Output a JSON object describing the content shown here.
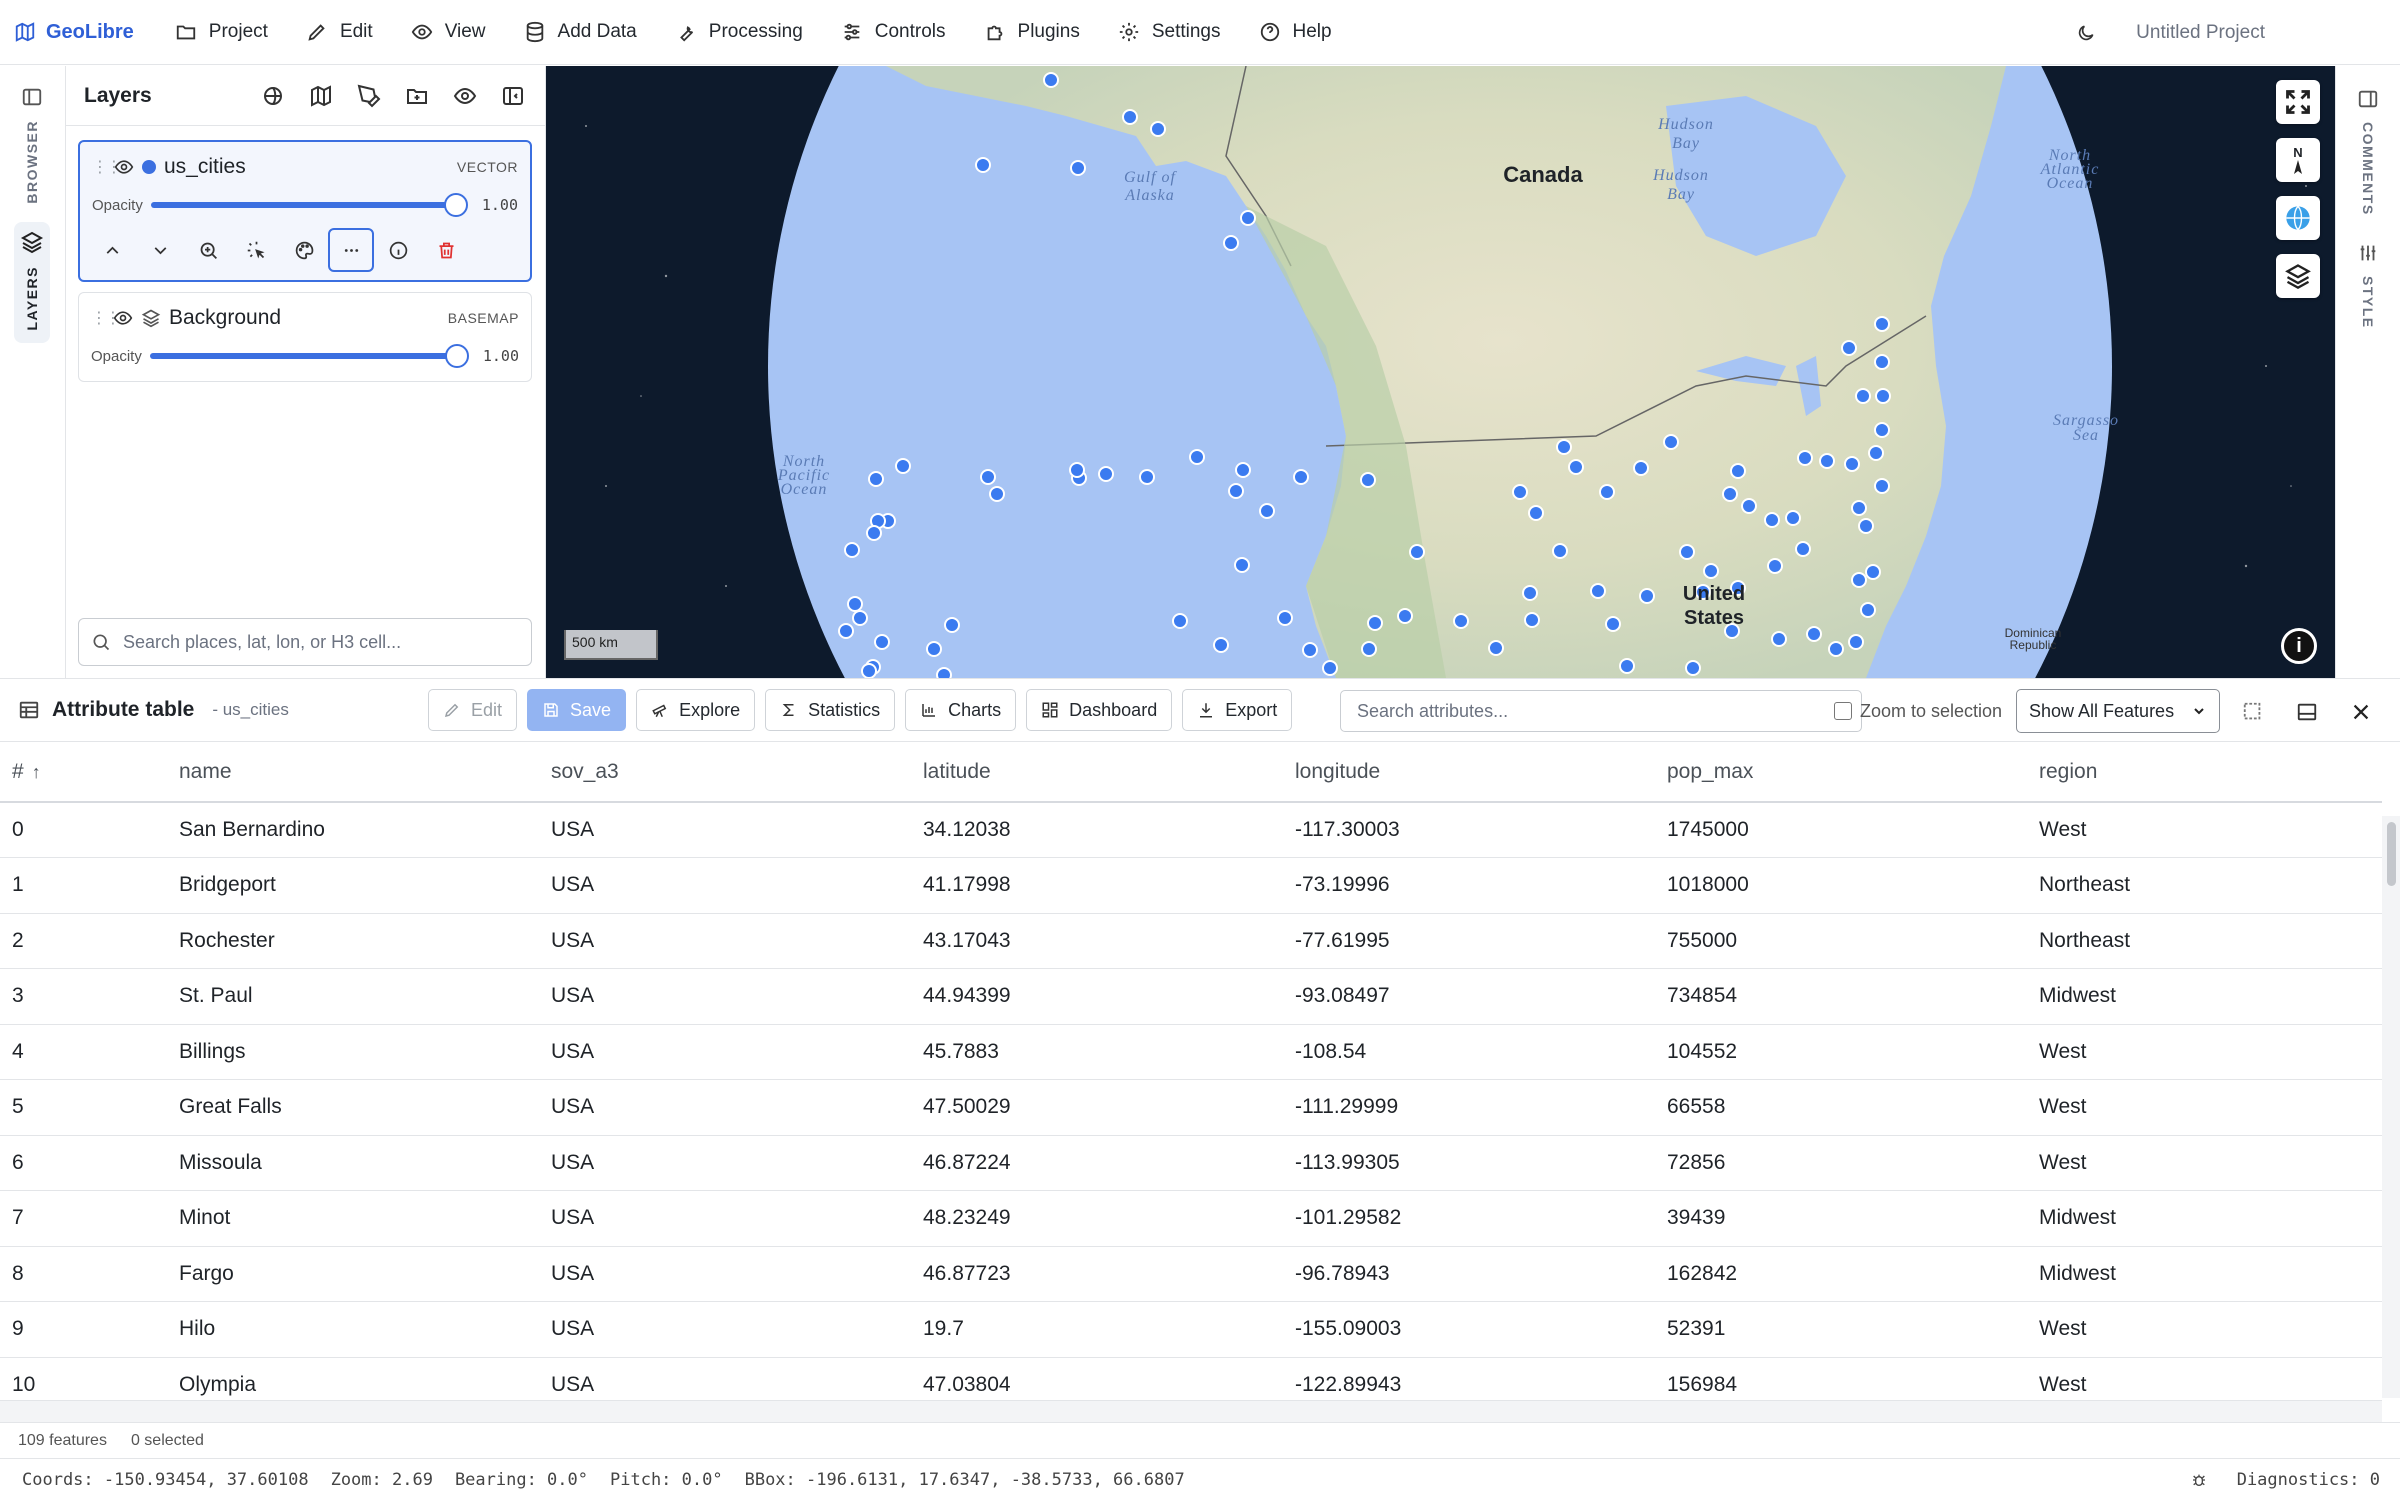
{
  "app": {
    "brand": "GeoLibre",
    "project_name": "Untitled Project",
    "accent": "#2f5fd6"
  },
  "menu": [
    {
      "label": "Project",
      "icon": "folder-icon"
    },
    {
      "label": "Edit",
      "icon": "pencil-icon"
    },
    {
      "label": "View",
      "icon": "eye-icon"
    },
    {
      "label": "Add Data",
      "icon": "database-icon"
    },
    {
      "label": "Processing",
      "icon": "wrench-icon"
    },
    {
      "label": "Controls",
      "icon": "sliders-icon"
    },
    {
      "label": "Plugins",
      "icon": "puzzle-icon"
    },
    {
      "label": "Settings",
      "icon": "gear-icon"
    },
    {
      "label": "Help",
      "icon": "help-circle-icon"
    }
  ],
  "left_rail": {
    "browser": "BROWSER",
    "layers": "LAYERS"
  },
  "right_rail": {
    "comments": "COMMENTS",
    "style": "STYLE"
  },
  "layers_panel": {
    "title": "Layers",
    "layers": [
      {
        "name": "us_cities",
        "type": "VECTOR",
        "opacity_label": "Opacity",
        "opacity": "1.00",
        "color": "#3b6fe0"
      },
      {
        "name": "Background",
        "type": "BASEMAP",
        "opacity_label": "Opacity",
        "opacity": "1.00"
      }
    ],
    "search_placeholder": "Search places, lat, lon, or H3 cell..."
  },
  "map": {
    "labels": {
      "canada": "Canada",
      "us_line1": "United",
      "us_line2": "States",
      "hudson_bay": "Hudson Bay",
      "gulf_alaska": "Gulf of Alaska",
      "north_pacific": "North Pacific Ocean",
      "north_atlantic": "North Atlantic Ocean",
      "sargasso": "Sargasso Sea",
      "dominican": "Dominican Republic"
    },
    "scale": "500 km",
    "compass": "N"
  },
  "attribute_table": {
    "title": "Attribute table",
    "layer": "- us_cities",
    "buttons": {
      "edit": "Edit",
      "save": "Save",
      "explore": "Explore",
      "statistics": "Statistics",
      "charts": "Charts",
      "dashboard": "Dashboard",
      "export": "Export"
    },
    "search_placeholder": "Search attributes...",
    "zoom_to_selection": "Zoom to selection",
    "filter_select": "Show All Features",
    "columns": [
      "#",
      "name",
      "sov_a3",
      "latitude",
      "longitude",
      "pop_max",
      "region"
    ],
    "rows": [
      [
        "0",
        "San Bernardino",
        "USA",
        "34.12038",
        "-117.30003",
        "1745000",
        "West"
      ],
      [
        "1",
        "Bridgeport",
        "USA",
        "41.17998",
        "-73.19996",
        "1018000",
        "Northeast"
      ],
      [
        "2",
        "Rochester",
        "USA",
        "43.17043",
        "-77.61995",
        "755000",
        "Northeast"
      ],
      [
        "3",
        "St. Paul",
        "USA",
        "44.94399",
        "-93.08497",
        "734854",
        "Midwest"
      ],
      [
        "4",
        "Billings",
        "USA",
        "45.7883",
        "-108.54",
        "104552",
        "West"
      ],
      [
        "5",
        "Great Falls",
        "USA",
        "47.50029",
        "-111.29999",
        "66558",
        "West"
      ],
      [
        "6",
        "Missoula",
        "USA",
        "46.87224",
        "-113.99305",
        "72856",
        "West"
      ],
      [
        "7",
        "Minot",
        "USA",
        "48.23249",
        "-101.29582",
        "39439",
        "Midwest"
      ],
      [
        "8",
        "Fargo",
        "USA",
        "46.87723",
        "-96.78943",
        "162842",
        "Midwest"
      ],
      [
        "9",
        "Hilo",
        "USA",
        "19.7",
        "-155.09003",
        "52391",
        "West"
      ],
      [
        "10",
        "Olympia",
        "USA",
        "47.03804",
        "-122.89943",
        "156984",
        "West"
      ]
    ],
    "feature_count": "109 features",
    "selected_count": "0 selected"
  },
  "status": {
    "coords": "Coords: -150.93454, 37.60108",
    "zoom": "Zoom: 2.69",
    "bearing": "Bearing: 0.0°",
    "pitch": "Pitch: 0.0°",
    "bbox": "BBox: -196.6131, 17.6347, -38.5733, 66.6807",
    "diagnostics": "Diagnostics: 0"
  }
}
